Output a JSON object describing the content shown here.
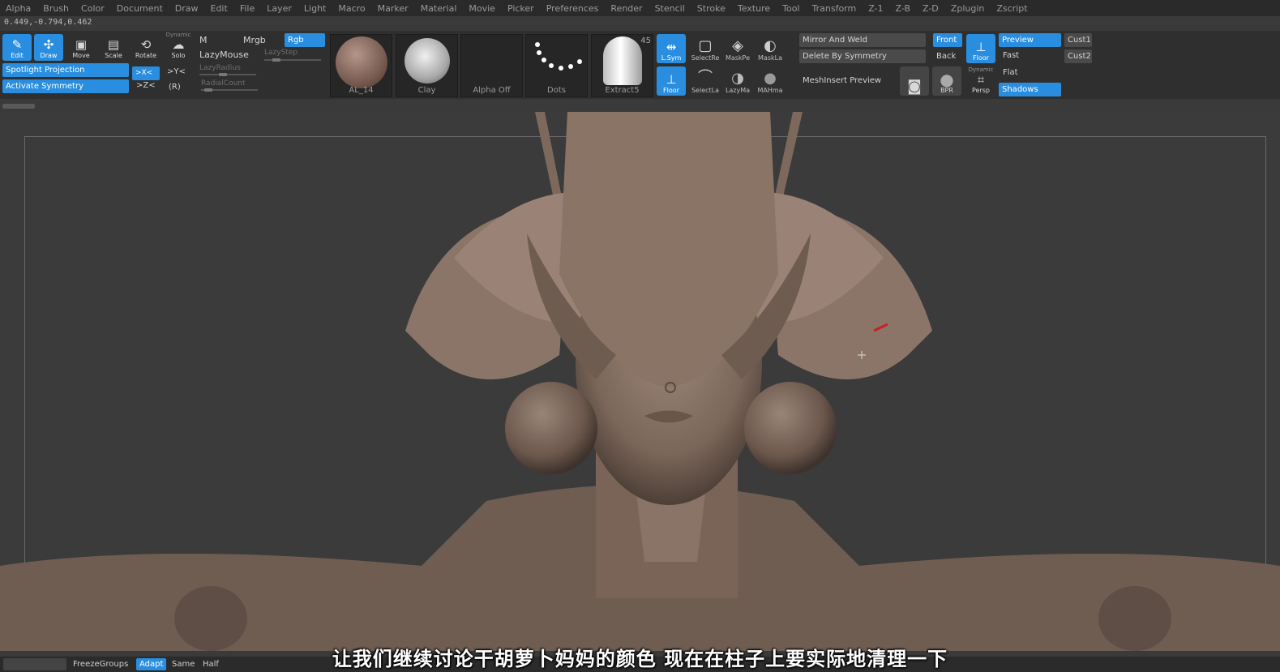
{
  "menu": [
    "Alpha",
    "Brush",
    "Color",
    "Document",
    "Draw",
    "Edit",
    "File",
    "Layer",
    "Light",
    "Macro",
    "Marker",
    "Material",
    "Movie",
    "Picker",
    "Preferences",
    "Render",
    "Stencil",
    "Stroke",
    "Texture",
    "Tool",
    "Transform",
    "Z-1",
    "Z-B",
    "Z-D",
    "Zplugin",
    "Zscript"
  ],
  "coords": "0.449,-0.794,0.462",
  "tools": {
    "edit": "Edit",
    "draw": "Draw",
    "move": "Move",
    "scale": "Scale",
    "rotate": "Rotate",
    "dynamic": "Dynamic",
    "solo": "Solo"
  },
  "modes": {
    "m": "M",
    "mrgb": "Mrgb",
    "rgb": "Rgb"
  },
  "lazymouse": "LazyMouse",
  "lazystep": "LazyStep",
  "lazyradius": "LazyRadius",
  "radialcount": "RadialCount",
  "spotlight": "Spotlight Projection",
  "activate_symmetry": "Activate Symmetry",
  "axes": {
    "x": ">X<",
    "y": ">Y<",
    "z": ">Z<",
    "r": "(R)"
  },
  "thumbs": [
    "AL_14",
    "Clay",
    "Alpha Off",
    "Dots",
    "Extract5"
  ],
  "extract_num": "45",
  "small_tools": {
    "lsym": "L.Sym",
    "floor": "Floor",
    "selectr": "SelectRe",
    "maskpe": "MaskPe",
    "maskla": "MaskLa",
    "selectl": "SelectLa",
    "lazyma": "LazyMa",
    "mahma": "MAHma"
  },
  "mirror_weld": "Mirror And Weld",
  "delete_sym": "Delete By Symmetry",
  "meshinsert": "MeshInsert Preview",
  "front": "Front",
  "back": "Back",
  "floor2": "Floor",
  "preview": "Preview",
  "fast": "Fast",
  "flat": "Flat",
  "shadows": "Shadows",
  "cust1": "Cust1",
  "cust2": "Cust2",
  "bpr": "BPR",
  "persp_top": "Dynamic",
  "persp": "Persp",
  "bottom": {
    "freeze": "FreezeGroups",
    "adapt": "Adapt",
    "same": "Same",
    "half": "Half"
  },
  "subtitle": "让我们继续讨论干胡萝卜妈妈的颜色 现在在柱子上要实际地清理一下",
  "colors": {
    "accent": "#2a8ee0",
    "clay": "#8a776b"
  }
}
